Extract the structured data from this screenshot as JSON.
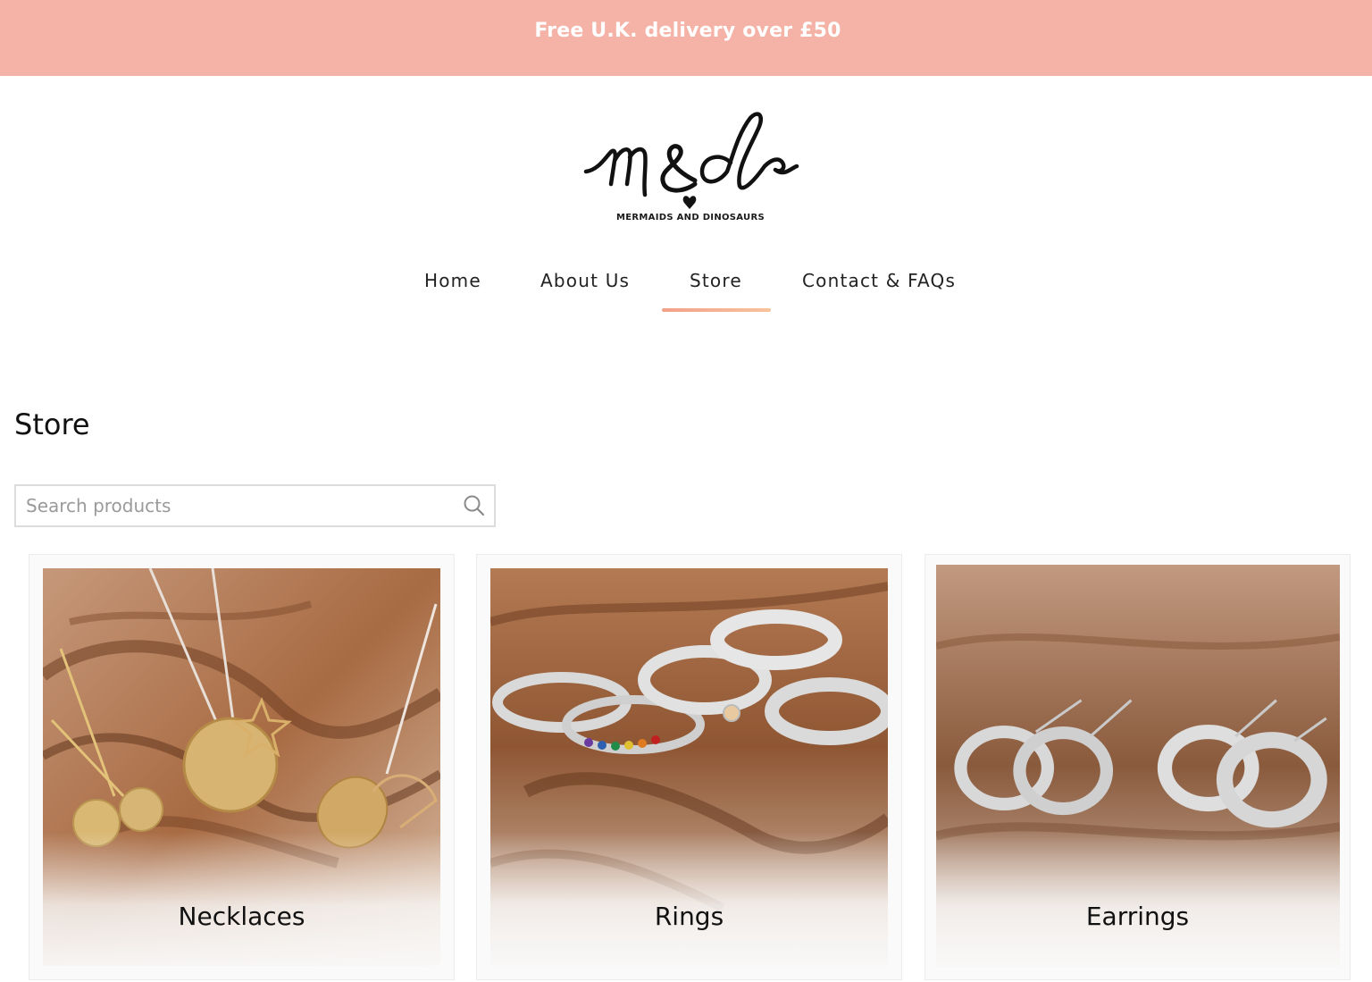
{
  "colors": {
    "banner": "#f5b2a6",
    "active_underline_start": "#f3a089",
    "active_underline_end": "#f7c39b"
  },
  "banner": {
    "text": "Free U.K. delivery over £50"
  },
  "logo": {
    "script": "m&d",
    "subtitle": "MERMAIDS AND DINOSAURS"
  },
  "nav": {
    "items": [
      {
        "label": "Home",
        "active": false
      },
      {
        "label": "About Us",
        "active": false
      },
      {
        "label": "Store",
        "active": true
      },
      {
        "label": "Contact & FAQs",
        "active": false
      }
    ]
  },
  "page": {
    "title": "Store"
  },
  "search": {
    "placeholder": "Search products",
    "value": "",
    "icon": "search-icon"
  },
  "categories": [
    {
      "label": "Necklaces",
      "image": "necklaces-photo"
    },
    {
      "label": "Rings",
      "image": "rings-photo"
    },
    {
      "label": "Earrings",
      "image": "earrings-photo"
    }
  ]
}
